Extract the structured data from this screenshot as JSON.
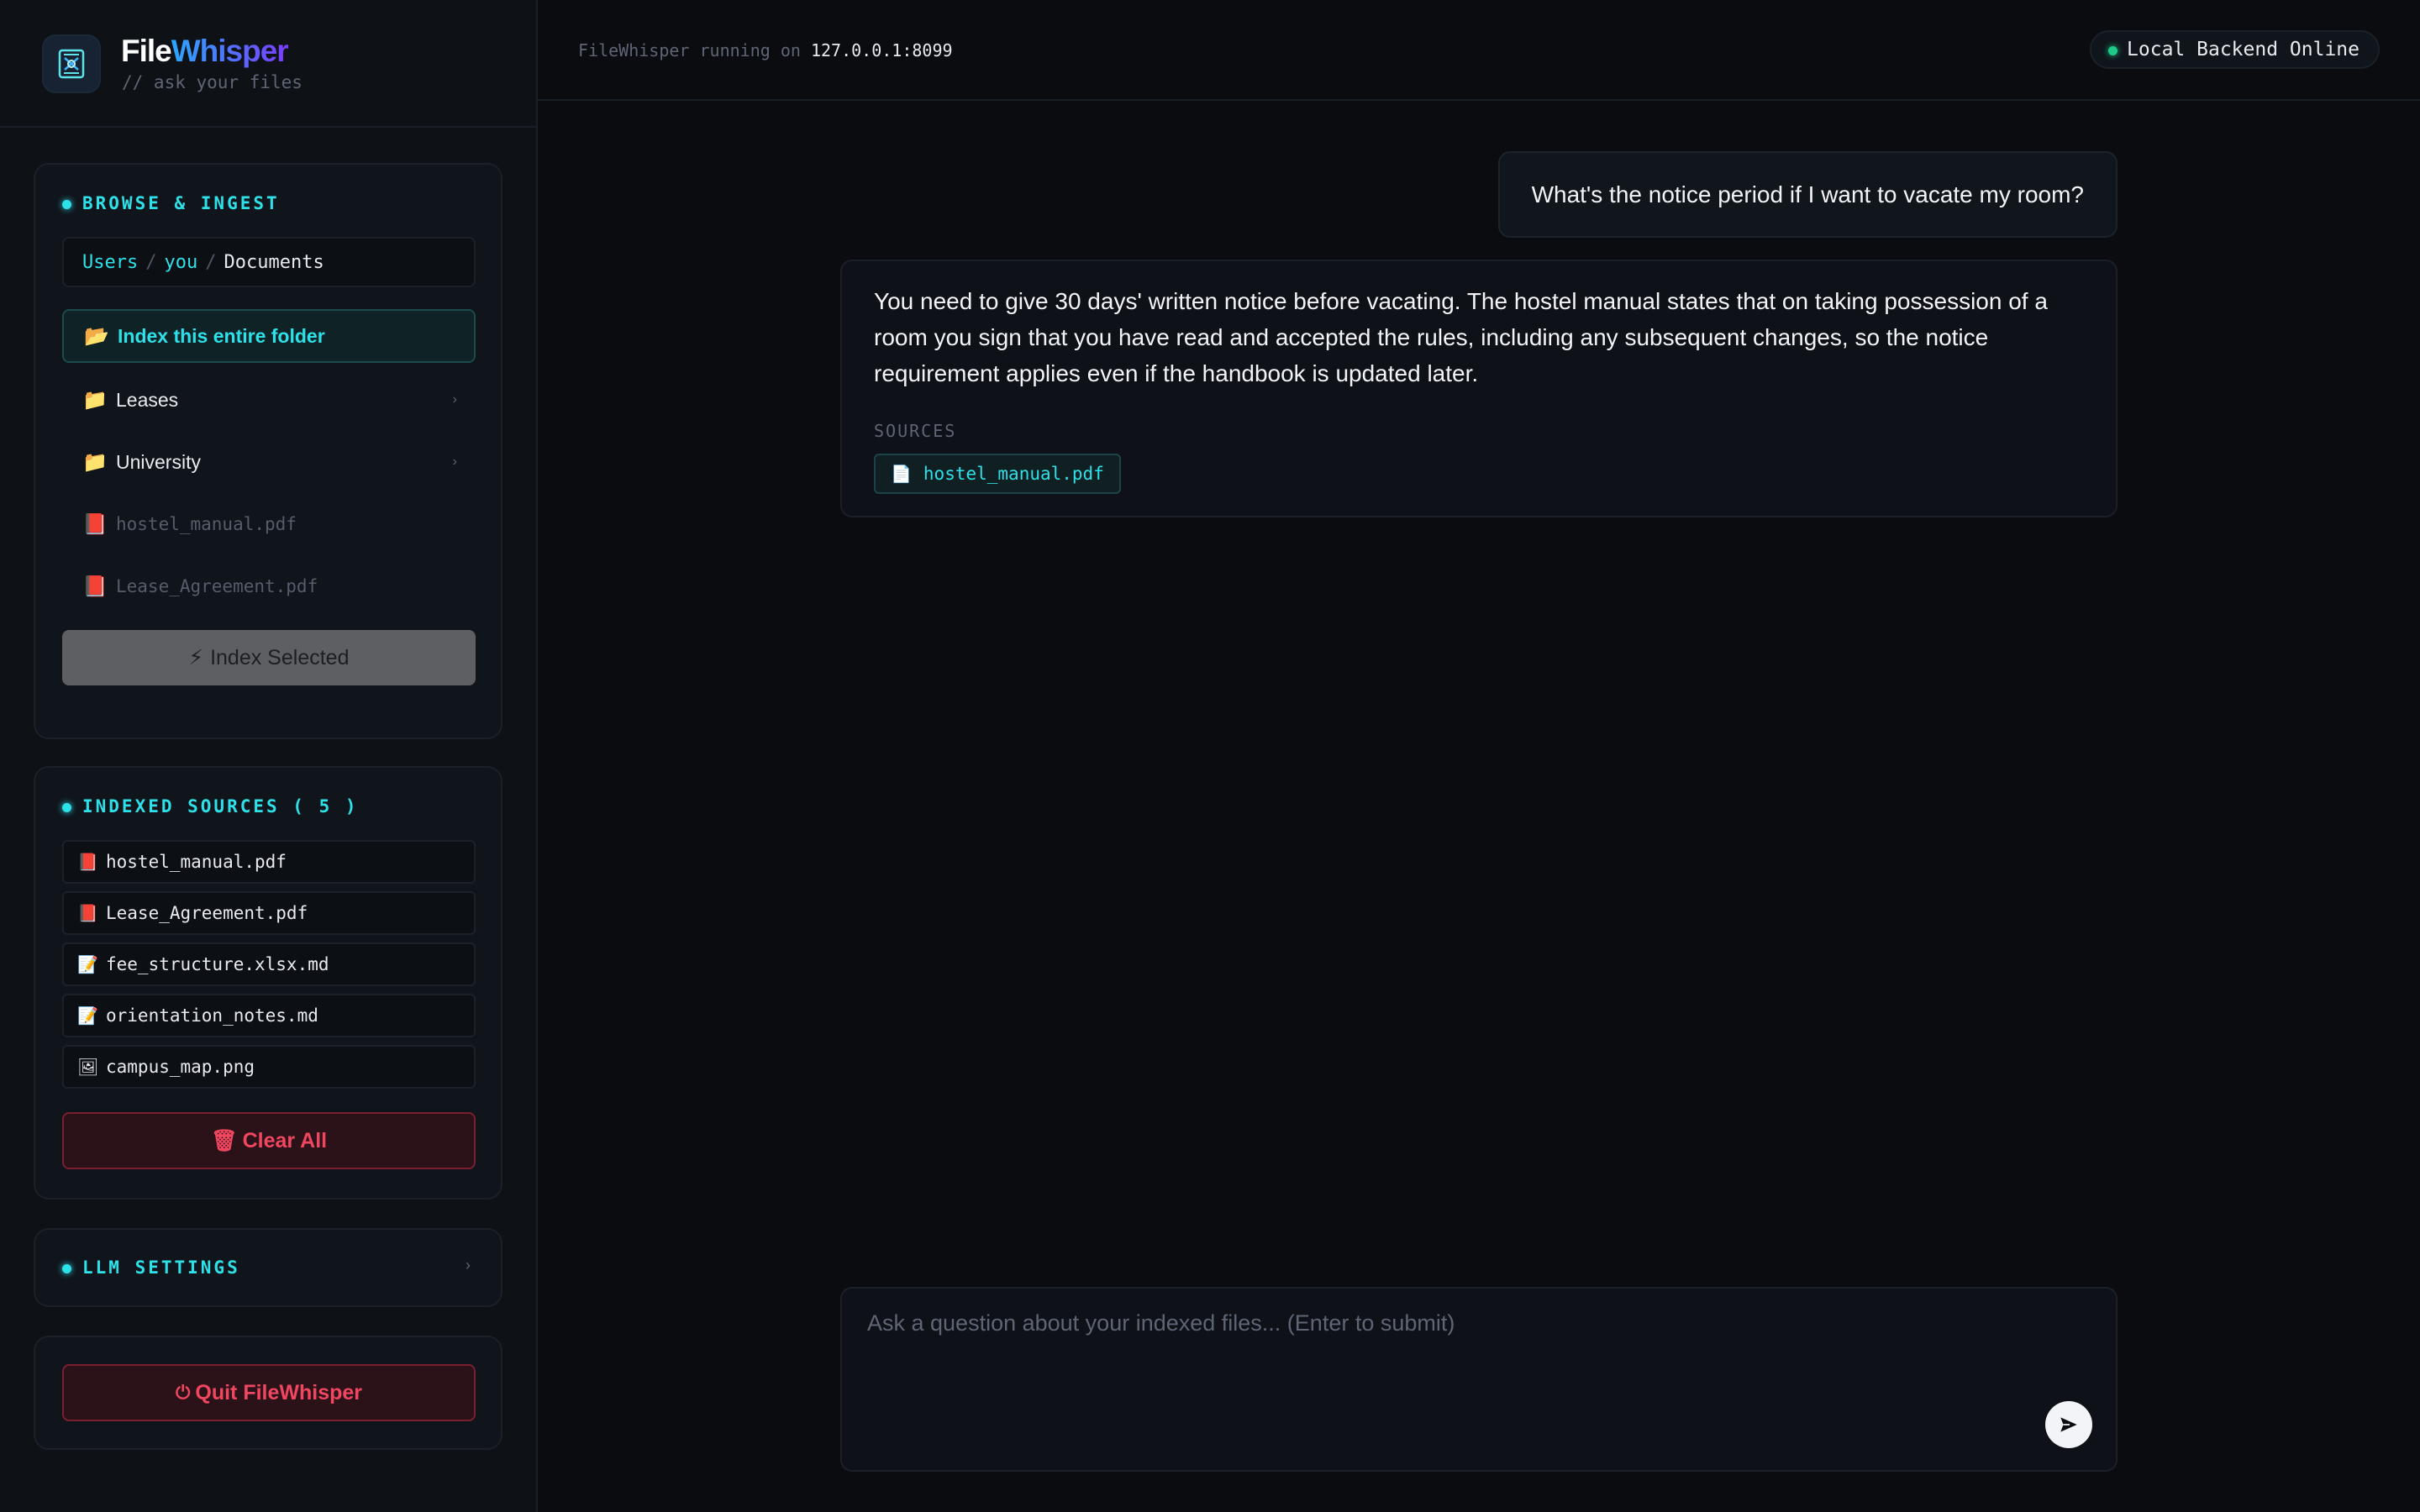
{
  "brand": {
    "name_part1": "File",
    "name_part2": "Whisper",
    "tagline": "// ask your files"
  },
  "topbar": {
    "running_prefix": "FileWhisper running on",
    "address": "127.0.0.1:8099",
    "status": "Local Backend Online",
    "status_color": "#1ec98a"
  },
  "browse": {
    "title": "BROWSE & INGEST",
    "breadcrumb": [
      "Users",
      "you",
      "Documents"
    ],
    "index_folder_label": "Index this entire folder",
    "folders": [
      {
        "name": "Leases",
        "icon": "folder-icon"
      },
      {
        "name": "University",
        "icon": "folder-icon"
      }
    ],
    "files": [
      {
        "name": "hostel_manual.pdf",
        "icon": "pdf-book-icon"
      },
      {
        "name": "Lease_Agreement.pdf",
        "icon": "pdf-book-icon"
      }
    ],
    "index_selected_label": "Index Selected"
  },
  "indexed": {
    "title": "INDEXED SOURCES ( 5 )",
    "items": [
      {
        "name": "hostel_manual.pdf",
        "icon": "pdf-book-icon"
      },
      {
        "name": "Lease_Agreement.pdf",
        "icon": "pdf-book-icon"
      },
      {
        "name": "fee_structure.xlsx.md",
        "icon": "memo-icon"
      },
      {
        "name": "orientation_notes.md",
        "icon": "memo-icon"
      },
      {
        "name": "campus_map.png",
        "icon": "image-icon"
      }
    ],
    "clear_label": "Clear All"
  },
  "llm": {
    "title": "LLM SETTINGS"
  },
  "quit_label": "Quit FileWhisper",
  "chat": {
    "user_message": "What's the notice period if I want to vacate my room?",
    "assistant_message": "You need to give 30 days' written notice before vacating. The hostel manual states that on taking possession of a room you sign that you have read and accepted the rules, including any subsequent changes, so the notice requirement applies even if the handbook is updated later.",
    "sources_label": "SOURCES",
    "sources": [
      "hostel_manual.pdf"
    ]
  },
  "composer": {
    "placeholder": "Ask a question about your indexed files... (Enter to submit)"
  },
  "colors": {
    "accent": "#2ee0e8",
    "danger": "#f0465f",
    "background": "#0b0c0f"
  }
}
